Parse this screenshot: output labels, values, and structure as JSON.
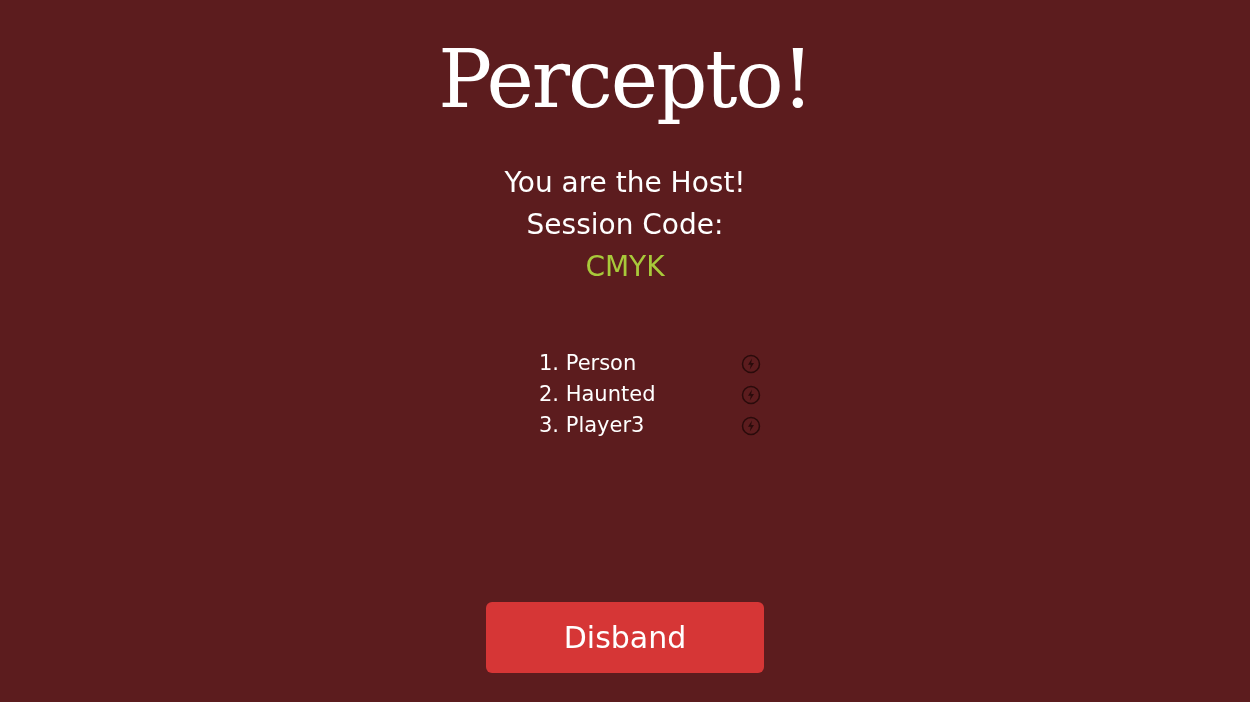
{
  "title": "Percepto!",
  "host_message": "You are the Host!",
  "session_label": "Session Code:",
  "session_code": "CMYK",
  "players": [
    {
      "label": "1. Person"
    },
    {
      "label": "2. Haunted"
    },
    {
      "label": "3. Player3"
    }
  ],
  "disband_button": "Disband"
}
